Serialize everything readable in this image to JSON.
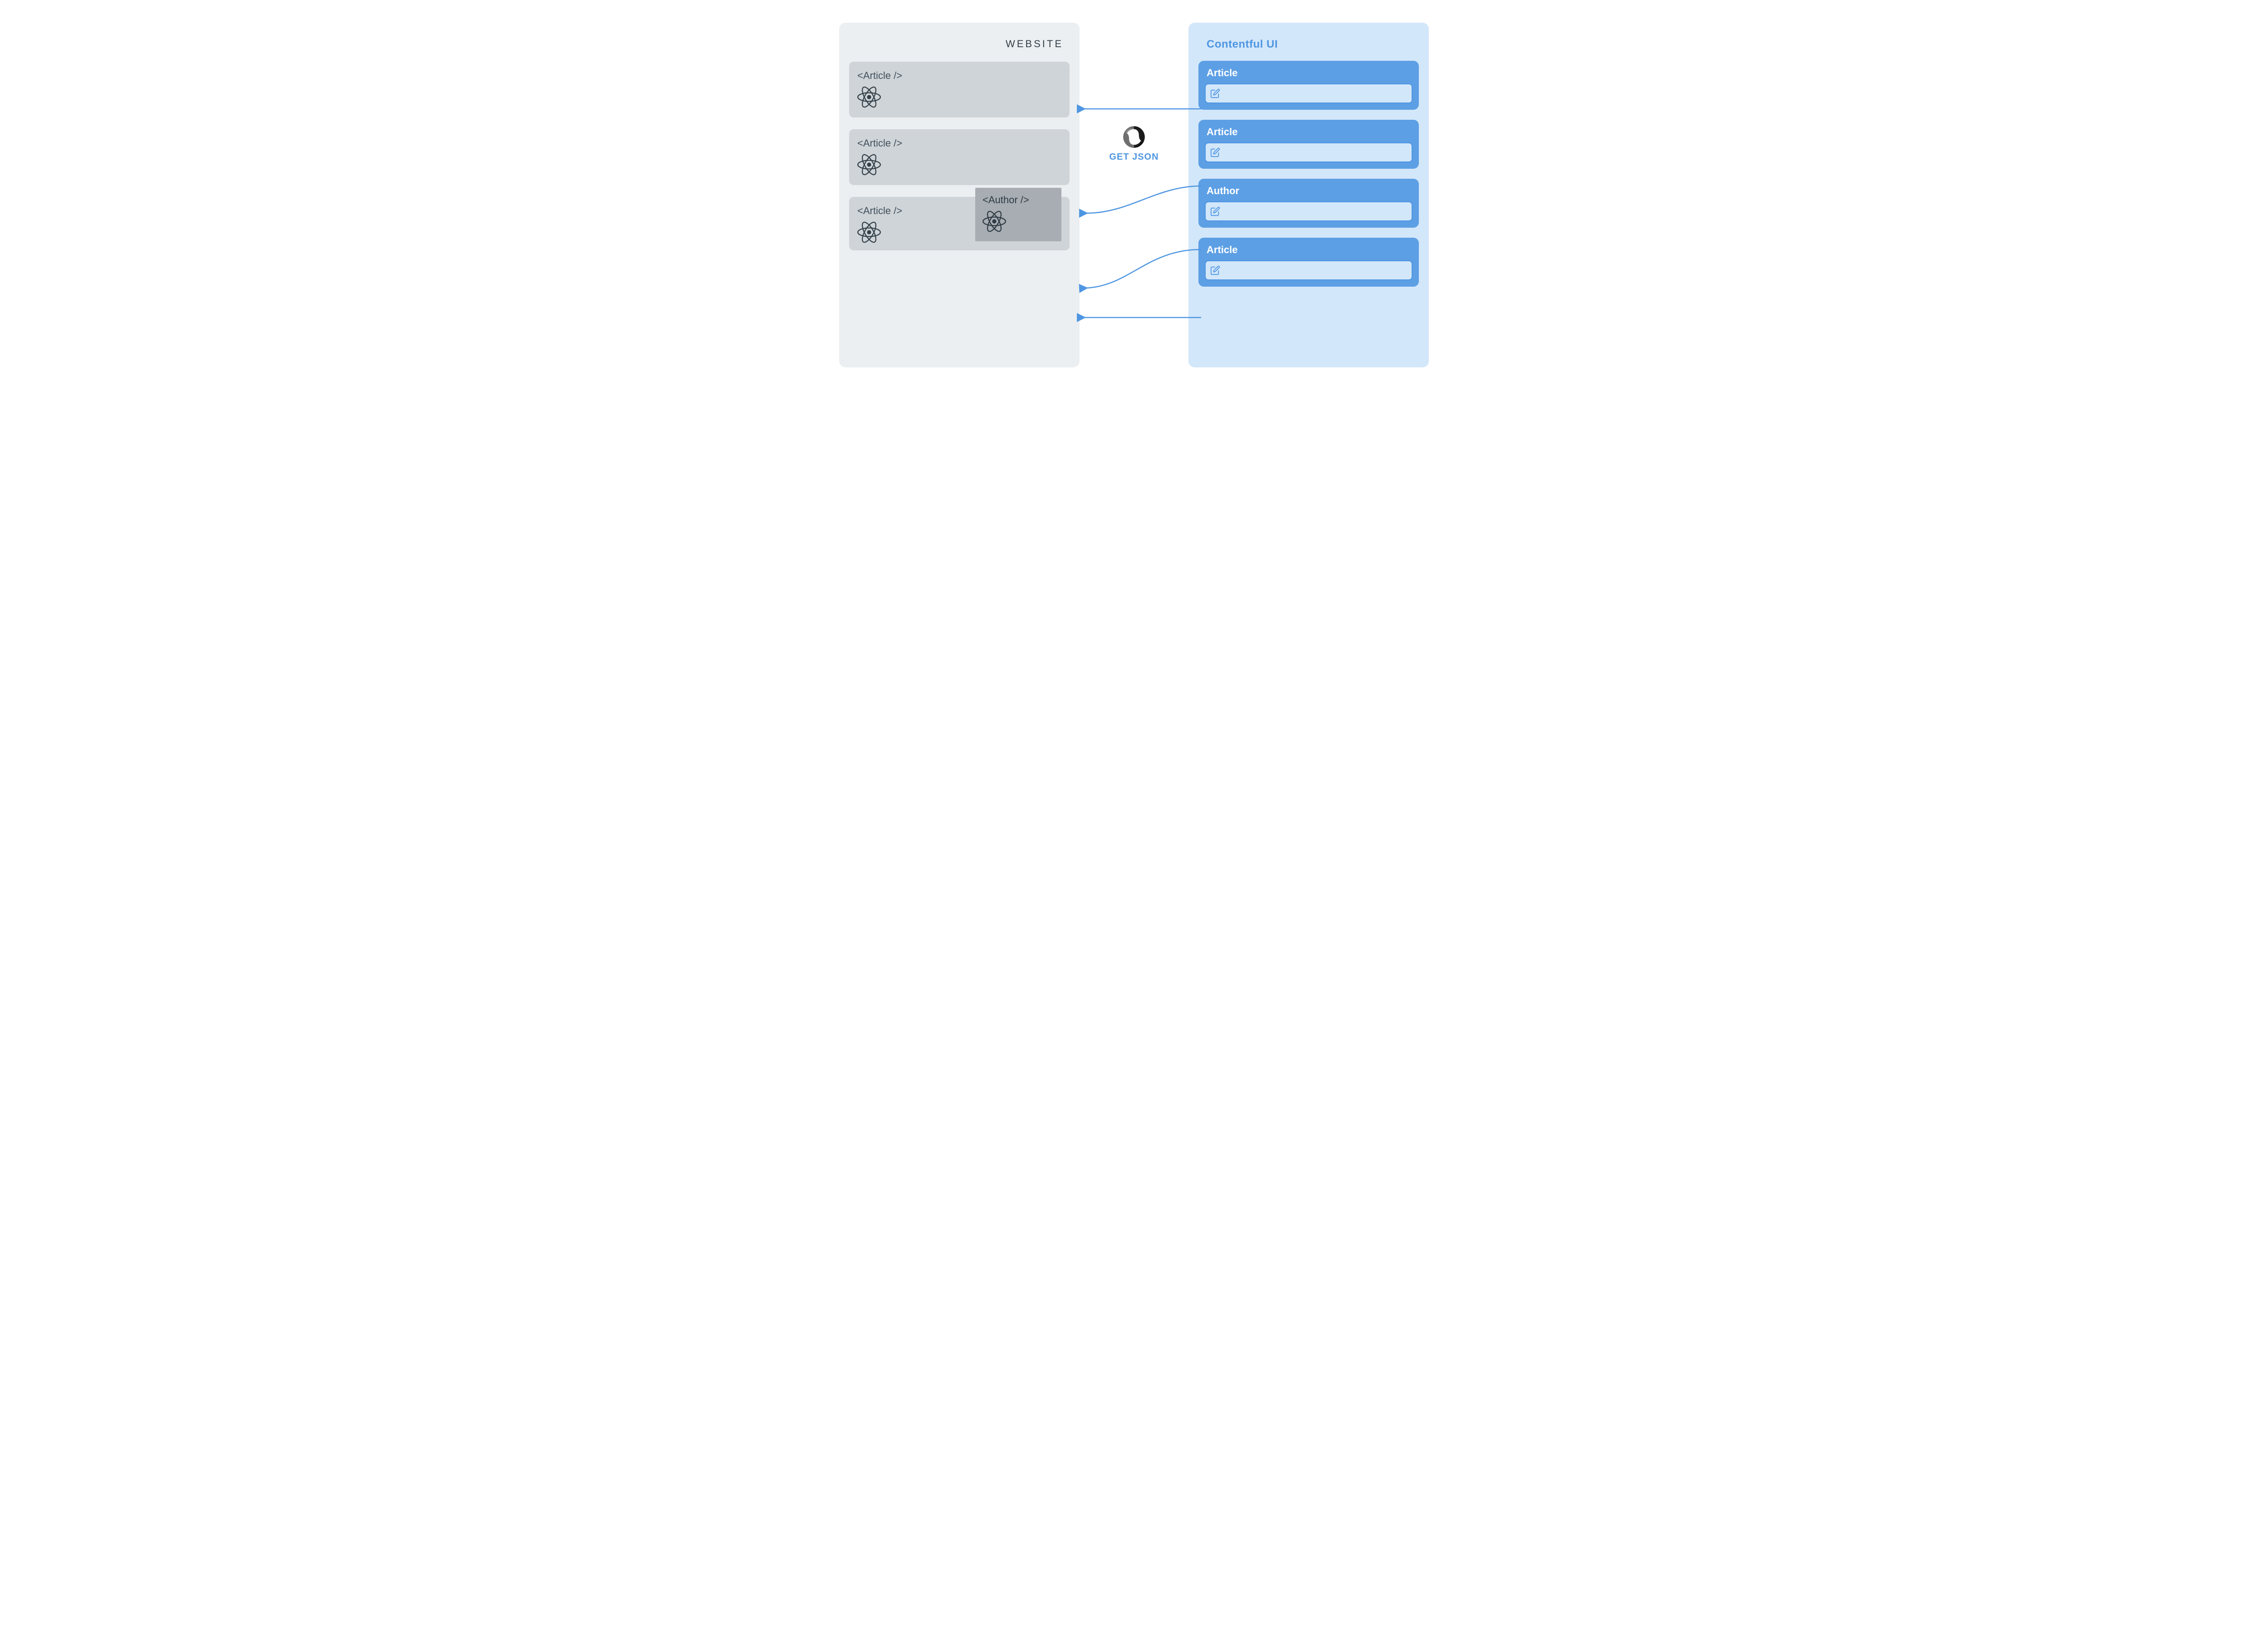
{
  "left_panel": {
    "title": "WEBSITE",
    "cards": [
      {
        "label": "<Article />"
      },
      {
        "label": "<Article />"
      },
      {
        "label": "<Article />",
        "nested": {
          "label": "<Author />"
        }
      }
    ]
  },
  "right_panel": {
    "title": "Contentful UI",
    "cards": [
      {
        "title": "Article"
      },
      {
        "title": "Article"
      },
      {
        "title": "Author"
      },
      {
        "title": "Article"
      }
    ]
  },
  "center": {
    "label": "GET JSON"
  },
  "colors": {
    "left_bg": "#eceff1",
    "left_card": "#cfd4d8",
    "left_nested": "#a7adb3",
    "right_bg": "#d3e7fa",
    "right_card": "#5d9fe4",
    "accent": "#4e96e2",
    "text_dark": "#334049"
  }
}
